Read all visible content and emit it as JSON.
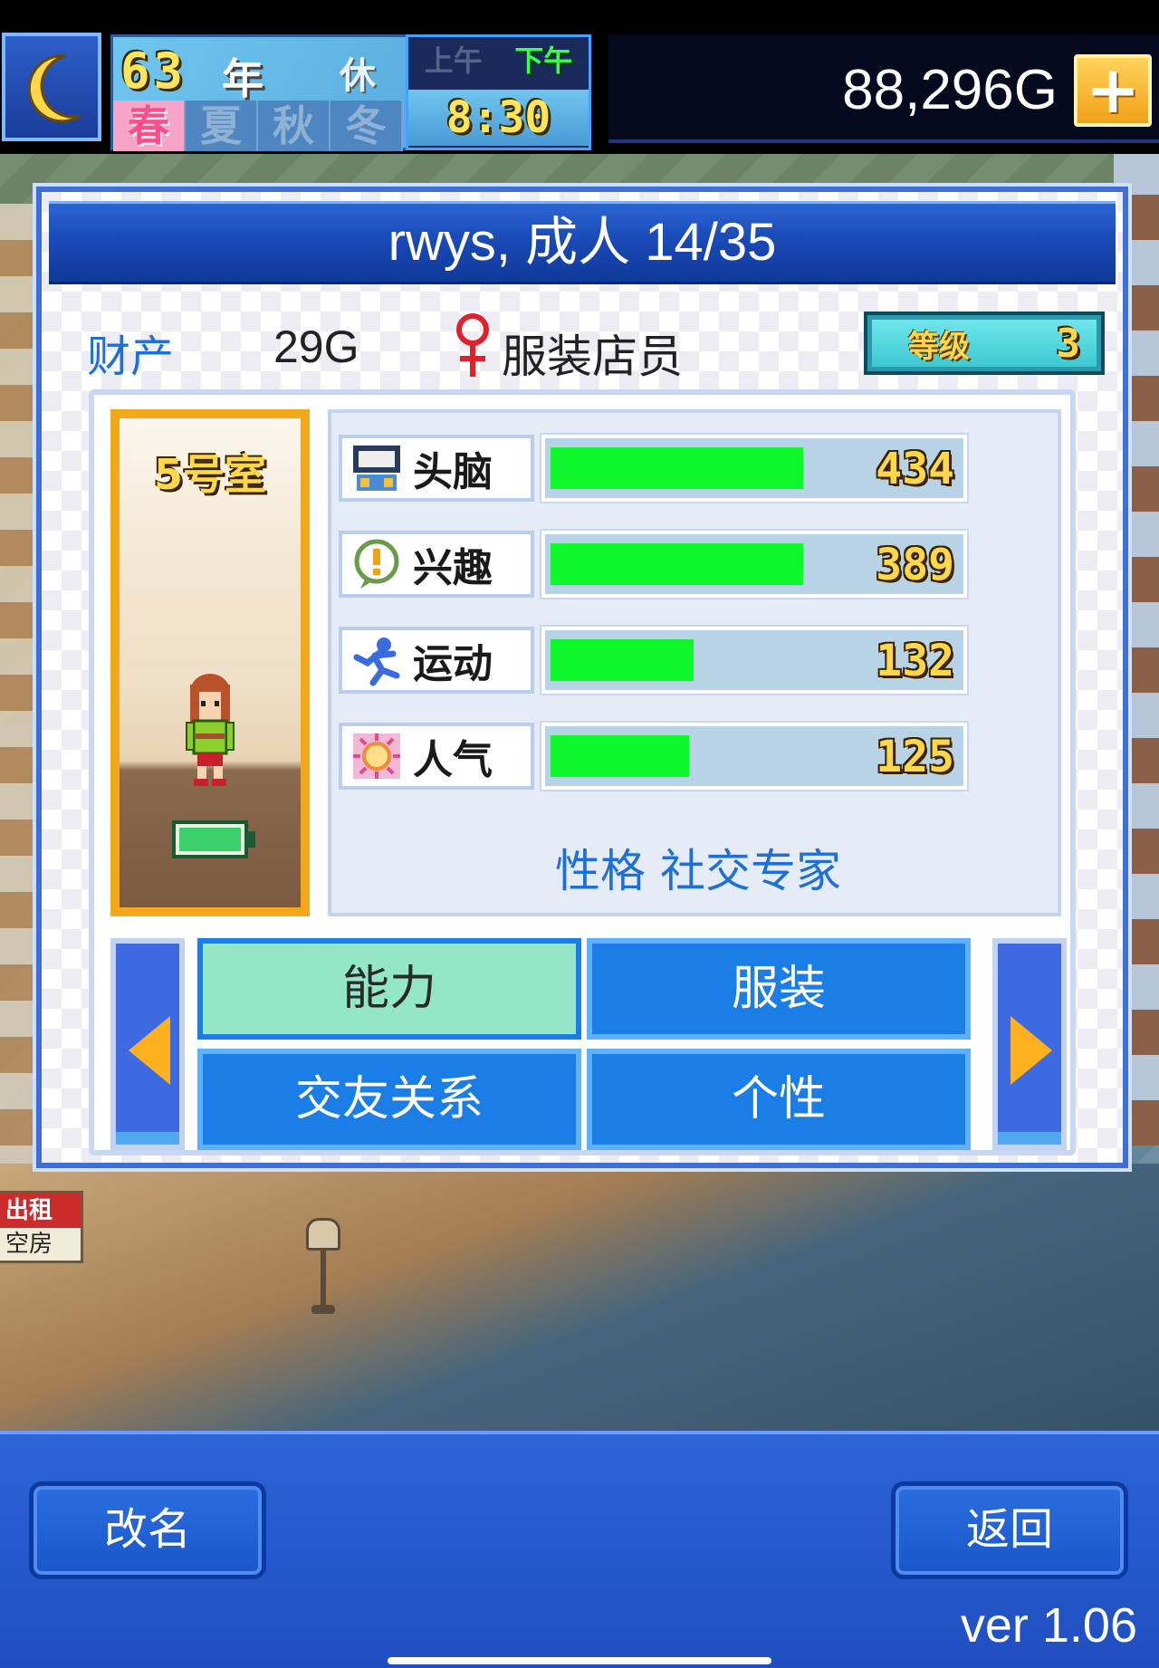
{
  "hud": {
    "year_number": "63",
    "year_label": "年",
    "holiday_label": "休日",
    "seasons": [
      "春",
      "夏",
      "秋",
      "冬"
    ],
    "active_season": "春",
    "am_label": "上午",
    "pm_label": "下午",
    "active_period": "下午",
    "time": "8:30",
    "money": "88,296G",
    "plus_label": "+"
  },
  "world": {
    "sign_top": "出租",
    "sign_bottom": "空房"
  },
  "dialog": {
    "title": "rwys, 成人 14/35",
    "asset_label": "财产",
    "asset_value": "29G",
    "gender_icon": "female-symbol-icon",
    "job": "服装店员",
    "level_label": "等级",
    "level_value": "3",
    "room": "5号室",
    "stats": [
      {
        "icon": "brain-icon",
        "name": "头脑",
        "value": 434,
        "fill": 0.62
      },
      {
        "icon": "interest-icon",
        "name": "兴趣",
        "value": 389,
        "fill": 0.62
      },
      {
        "icon": "sports-icon",
        "name": "运动",
        "value": 132,
        "fill": 0.35
      },
      {
        "icon": "popularity-icon",
        "name": "人气",
        "value": 125,
        "fill": 0.34
      }
    ],
    "personality": "性格 社交专家",
    "tabs": {
      "ability": "能力",
      "clothing": "服装",
      "relationships": "交友关系",
      "personality": "个性",
      "active": "能力"
    }
  },
  "bottom": {
    "rename_label": "改名",
    "back_label": "返回",
    "version": "ver 1.06"
  },
  "colors": {
    "bar_fill": "#0ef82c",
    "title_blue": "#1848b4",
    "accent_text": "#1e6fd8",
    "number_yellow": "#ffd84a"
  }
}
